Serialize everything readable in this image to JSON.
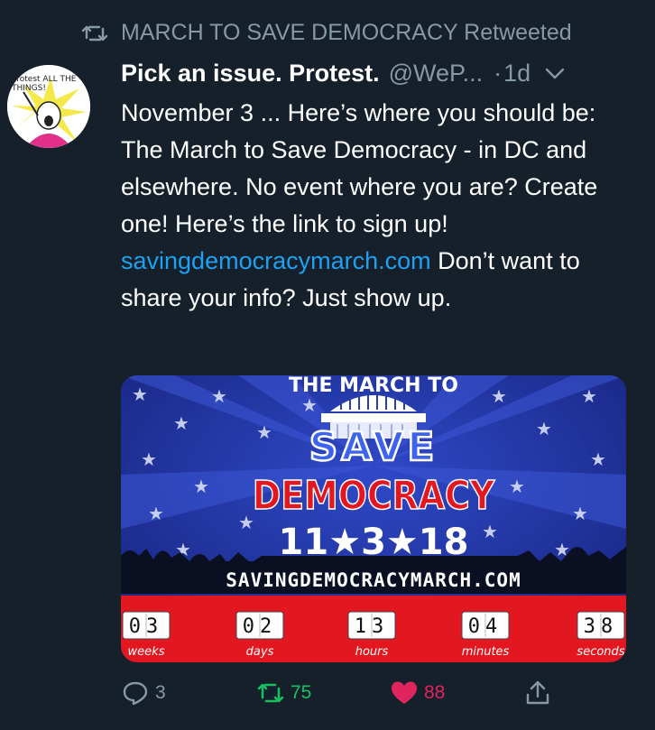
{
  "retweet": {
    "text": "MARCH TO SAVE DEMOCRACY Retweeted"
  },
  "avatar": {
    "text_top": "Protest ALL THE",
    "text_bottom": "THINGS!"
  },
  "tweet": {
    "display_name": "Pick an issue. Protest.",
    "handle": "@WeP...",
    "dot": "·",
    "time": "1d",
    "text_before": "November 3 ...  Here’s where you should be: The March to Save Democracy - in DC and elsewhere. No event where you are? Create one! Here’s the link to sign up! ",
    "link": "savingdemocracymarch.com",
    "text_after": " Don’t want to share your info? Just show up."
  },
  "media": {
    "arc_text": "THE MARCH TO",
    "save": "SAVE",
    "democracy": "DEMOCRACY",
    "date": "11★3★18",
    "url": "SAVINGDEMOCRACYMARCH.COM",
    "countdown": [
      {
        "value": "03",
        "unit": "weeks"
      },
      {
        "value": "02",
        "unit": "days"
      },
      {
        "value": "13",
        "unit": "hours"
      },
      {
        "value": "04",
        "unit": "minutes"
      },
      {
        "value": "38",
        "unit": "seconds"
      }
    ],
    "colors": {
      "blue": "#1c2d8f",
      "red": "#e3171f",
      "white": "#ffffff"
    }
  },
  "actions": {
    "reply_count": "3",
    "retweet_count": "75",
    "like_count": "88"
  },
  "colors": {
    "background": "#15202b",
    "muted": "#8899a6",
    "link": "#1da1f2",
    "retweet": "#17bf63",
    "like": "#e0245e"
  }
}
